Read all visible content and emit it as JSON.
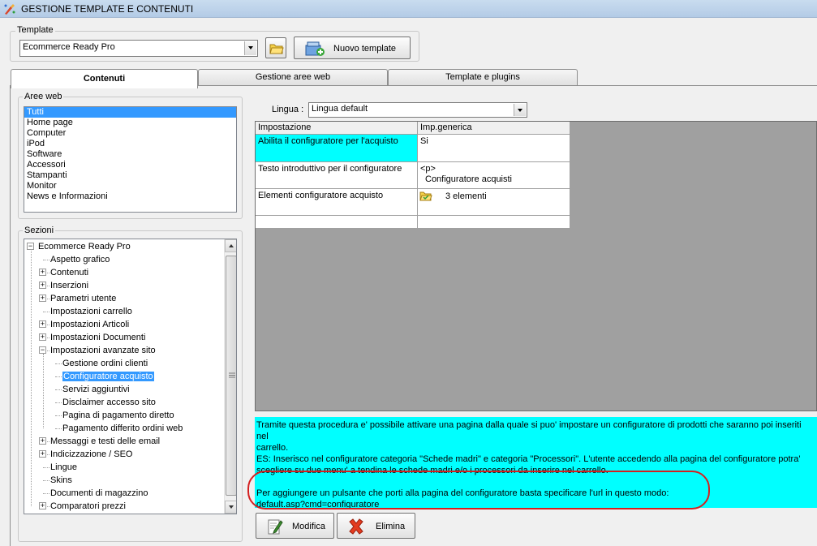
{
  "window": {
    "title": "GESTIONE TEMPLATE E CONTENUTI"
  },
  "template_group": {
    "label": "Template",
    "selected": "Ecommerce Ready Pro",
    "new_button": "Nuovo template"
  },
  "tabs": [
    {
      "label": "Contenuti",
      "active": true
    },
    {
      "label": "Gestione aree web",
      "active": false
    },
    {
      "label": "Template e plugins",
      "active": false
    }
  ],
  "aree_web": {
    "label": "Aree web",
    "items": [
      "Tutti",
      "Home page",
      "Computer",
      "iPod",
      "Software",
      "Accessori",
      "Stampanti",
      "Monitor",
      "News e Informazioni"
    ],
    "selected_index": 0
  },
  "sezioni": {
    "label": "Sezioni",
    "items": [
      {
        "label": "Ecommerce Ready Pro",
        "level": 0,
        "expander": "−"
      },
      {
        "label": "Aspetto grafico",
        "level": 1,
        "expander": ""
      },
      {
        "label": "Contenuti",
        "level": 1,
        "expander": "+"
      },
      {
        "label": "Inserzioni",
        "level": 1,
        "expander": "+"
      },
      {
        "label": "Parametri utente",
        "level": 1,
        "expander": "+"
      },
      {
        "label": "Impostazioni carrello",
        "level": 1,
        "expander": ""
      },
      {
        "label": "Impostazioni Articoli",
        "level": 1,
        "expander": "+"
      },
      {
        "label": "Impostazioni Documenti",
        "level": 1,
        "expander": "+"
      },
      {
        "label": "Impostazioni avanzate sito",
        "level": 1,
        "expander": "−"
      },
      {
        "label": "Gestione ordini clienti",
        "level": 2,
        "expander": ""
      },
      {
        "label": "Configuratore acquisto",
        "level": 2,
        "expander": "",
        "selected": true
      },
      {
        "label": "Servizi aggiuntivi",
        "level": 2,
        "expander": ""
      },
      {
        "label": "Disclaimer accesso sito",
        "level": 2,
        "expander": ""
      },
      {
        "label": "Pagina di pagamento diretto",
        "level": 2,
        "expander": ""
      },
      {
        "label": "Pagamento differito ordini web",
        "level": 2,
        "expander": ""
      },
      {
        "label": "Messaggi e testi delle email",
        "level": 1,
        "expander": "+"
      },
      {
        "label": "Indicizzazione / SEO",
        "level": 1,
        "expander": "+"
      },
      {
        "label": "Lingue",
        "level": 1,
        "expander": ""
      },
      {
        "label": "Skins",
        "level": 1,
        "expander": ""
      },
      {
        "label": "Documenti di magazzino",
        "level": 1,
        "expander": ""
      },
      {
        "label": "Comparatori prezzi",
        "level": 1,
        "expander": "+"
      }
    ]
  },
  "lingua": {
    "label": "Lingua :",
    "selected": "Lingua default"
  },
  "grid": {
    "columns": [
      "Impostazione",
      "Imp.generica"
    ],
    "rows": [
      {
        "name": "Abilita il configuratore per l'acquisto",
        "value": "Si",
        "highlight": true
      },
      {
        "name": "Testo introduttivo per il configuratore",
        "value_line1": "<p>",
        "value_line2": "Configuratore acquisti"
      },
      {
        "name": "Elementi configuratore acquisto",
        "value": "3 elementi",
        "icon": "folder-icon"
      }
    ]
  },
  "info": {
    "line1": "Tramite questa procedura e' possibile attivare una pagina dalla quale si puo' impostare un configuratore di prodotti che saranno poi inseriti nel",
    "line2": "carrello.",
    "line3": "ES: Inserisco nel configuratore categoria \"Schede madri\" e categoria \"Processori\". L'utente accedendo alla pagina del configuratore potra'",
    "line4": "scegliere su due menu' a tendina le schede madri e/o i processori da inserire nel carrello.",
    "line5": "Per aggiungere un pulsante che porti alla pagina del configuratore basta specificare l'url in questo modo:",
    "line6": "default.asp?cmd=configuratore"
  },
  "actions": {
    "modifica": "Modifica",
    "elimina": "Elimina"
  },
  "colors": {
    "selection": "#3399ff",
    "highlight_cyan": "#00ffff",
    "annotation_red": "#d42020"
  }
}
